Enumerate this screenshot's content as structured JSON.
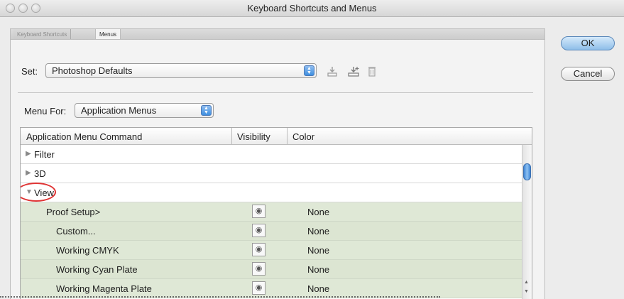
{
  "window": {
    "title": "Keyboard Shortcuts and Menus"
  },
  "tabs": [
    {
      "label": "Keyboard Shortcuts",
      "active": false
    },
    {
      "label": "Menus",
      "active": true
    }
  ],
  "set": {
    "label": "Set:",
    "value": "Photoshop Defaults"
  },
  "toolbar_icons": [
    "save-set-icon",
    "save-as-set-icon",
    "delete-set-icon"
  ],
  "menu_for": {
    "label": "Menu For:",
    "value": "Application Menus"
  },
  "table": {
    "headers": [
      "Application Menu Command",
      "Visibility",
      "Color"
    ],
    "rows": [
      {
        "label": "Filter",
        "kind": "group",
        "expanded": false
      },
      {
        "label": "3D",
        "kind": "group",
        "expanded": false
      },
      {
        "label": "View",
        "kind": "group",
        "expanded": true,
        "highlighted": true
      },
      {
        "label": "Proof Setup>",
        "kind": "item",
        "color": "None",
        "visible": true
      },
      {
        "label": "Custom...",
        "kind": "item",
        "color": "None",
        "visible": true
      },
      {
        "label": "Working CMYK",
        "kind": "item",
        "color": "None",
        "visible": true
      },
      {
        "label": "Working Cyan Plate",
        "kind": "item",
        "color": "None",
        "visible": true
      },
      {
        "label": "Working Magenta Plate",
        "kind": "item",
        "color": "None",
        "visible": true
      }
    ]
  },
  "buttons": {
    "ok": "OK",
    "cancel": "Cancel"
  },
  "colors": {
    "highlight_ring": "#e03535",
    "row_tint": "#dfe8d6",
    "default_button": "#8ebee9"
  }
}
